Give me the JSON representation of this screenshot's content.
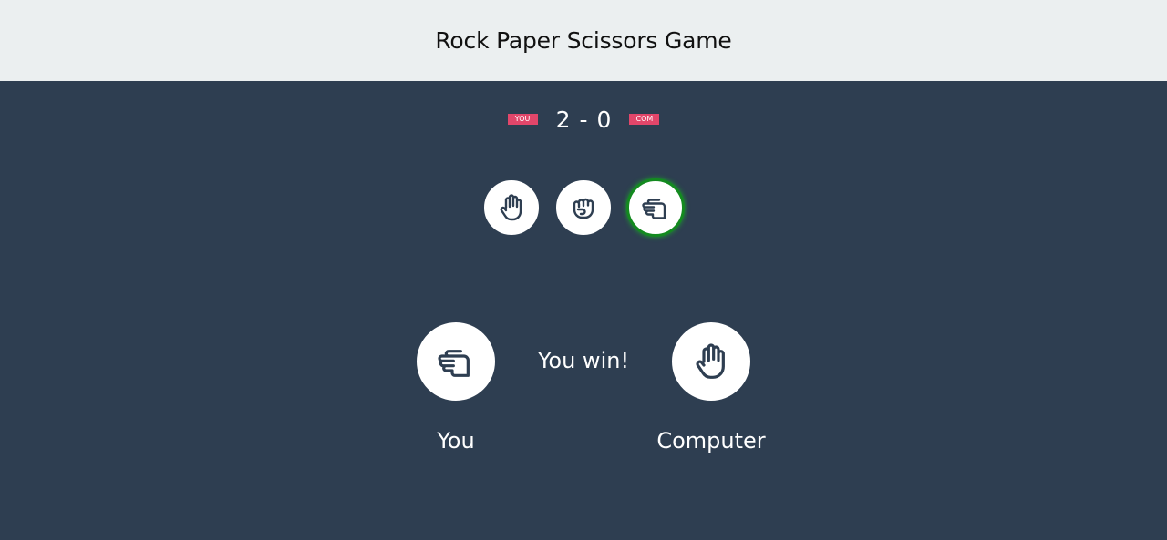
{
  "header": {
    "title": "Rock Paper Scissors Game"
  },
  "scoreboard": {
    "user_label": "YOU",
    "computer_label": "COM",
    "user_score": "2",
    "separator": "-",
    "computer_score": "0"
  },
  "choices": [
    {
      "id": "paper",
      "icon": "hand-paper-icon",
      "selected": false
    },
    {
      "id": "rock",
      "icon": "hand-rock-icon",
      "selected": false
    },
    {
      "id": "scissors",
      "icon": "hand-scissors-icon",
      "selected": true
    }
  ],
  "result": {
    "user_choice_icon": "hand-scissors-icon",
    "computer_choice_icon": "hand-paper-icon",
    "message": "You win!",
    "user_label": "You",
    "computer_label": "Computer"
  },
  "colors": {
    "background": "#2e3e51",
    "header_bg": "#ebeff0",
    "badge": "#e2466a",
    "selected_ring": "#138a1f"
  }
}
